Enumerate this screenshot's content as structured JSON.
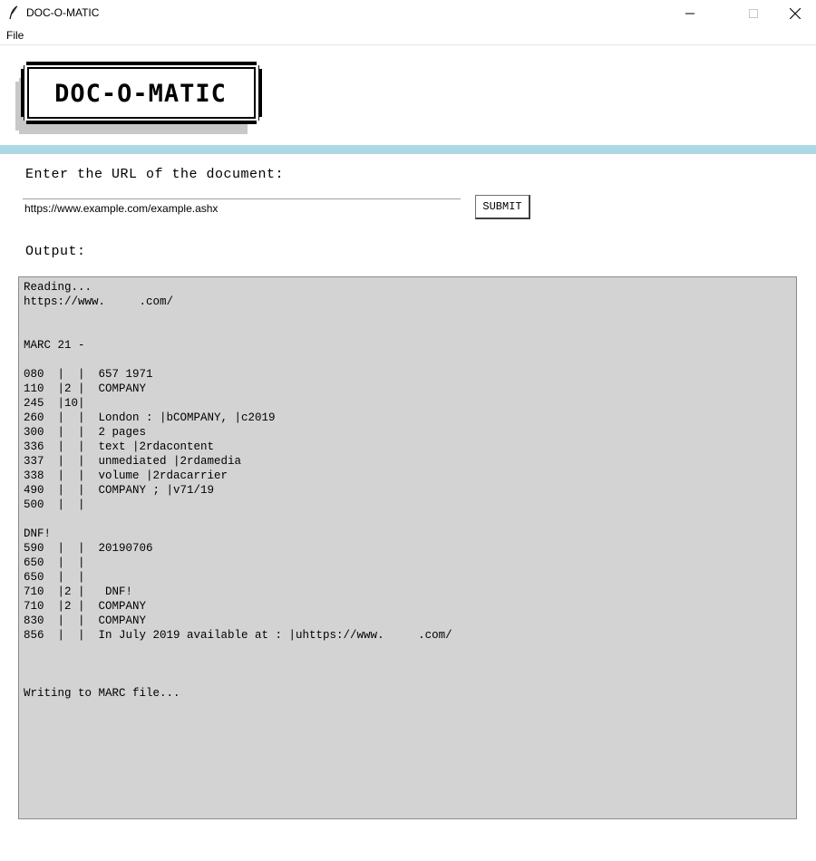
{
  "window": {
    "title": "DOC-O-MATIC",
    "icon": "feather-icon",
    "controls": {
      "minimize_icon": "minimize-icon",
      "maximize_icon": "maximize-icon",
      "close_icon": "close-icon"
    }
  },
  "menu": {
    "items": [
      {
        "label": "File"
      }
    ]
  },
  "logo": {
    "text": "DOC-O-MATIC"
  },
  "colors": {
    "accent_band": "#add8e6",
    "output_background": "#d3d3d3"
  },
  "form": {
    "prompt_label": "Enter the URL of the document:",
    "url_value": "https://www.example.com/example.ashx",
    "submit_label": "SUBMIT"
  },
  "output": {
    "label": "Output:",
    "lines": [
      "Reading...",
      "https://www.     .com/",
      "",
      "",
      "MARC 21 -",
      "",
      "080  |  |  657 1971",
      "110  |2 |  COMPANY",
      "245  |10|",
      "260  |  |  London : |bCOMPANY, |c2019",
      "300  |  |  2 pages",
      "336  |  |  text |2rdacontent",
      "337  |  |  unmediated |2rdamedia",
      "338  |  |  volume |2rdacarrier",
      "490  |  |  COMPANY ; |v71/19",
      "500  |  |",
      "",
      "DNF!",
      "590  |  |  20190706",
      "650  |  |",
      "650  |  |",
      "710  |2 |   DNF!",
      "710  |2 |  COMPANY",
      "830  |  |  COMPANY",
      "856  |  |  In July 2019 available at : |uhttps://www.     .com/",
      "",
      "",
      "",
      "Writing to MARC file..."
    ]
  }
}
